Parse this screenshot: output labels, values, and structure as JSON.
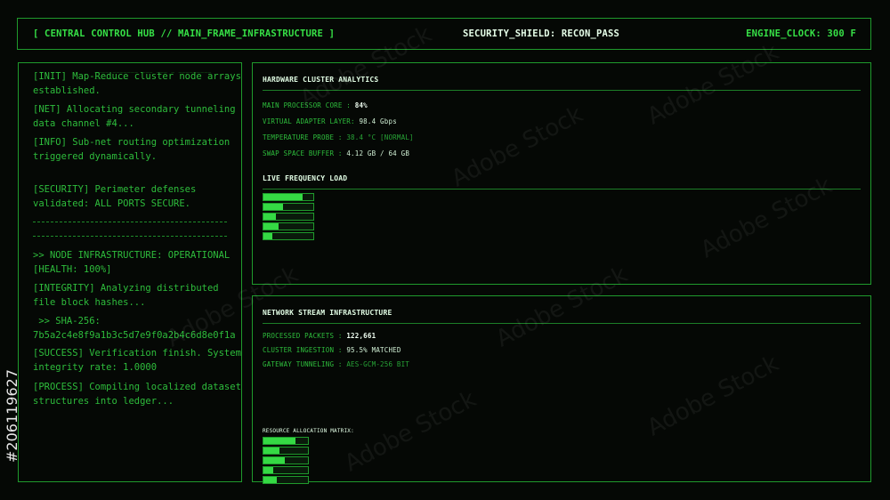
{
  "header": {
    "left": "[ CENTRAL CONTROL HUB // MAIN_FRAME_INFRASTRUCTURE ]",
    "middle": "SECURITY_SHIELD: RECON_PASS",
    "right": "ENGINE_CLOCK: 300 F"
  },
  "log": {
    "overlay": "____ _______ ___ ___ _ _________ _________",
    "entries": [
      "[INIT] Map-Reduce cluster node arrays established.",
      "[NET] Allocating secondary tunneling data channel #4...",
      "[INFO] Sub-net routing optimization triggered dynamically.",
      "[SECURITY] Perimeter defenses validated: ALL PORTS SECURE.",
      ">> NODE INFRASTRUCTURE: OPERATIONAL [HEALTH: 100%]",
      "[INTEGRITY] Analyzing distributed file block hashes...",
      " >> SHA-256:",
      "7b5a2c4e8f9a1b3c5d7e9f0a2b4c6d8e0f1a",
      "[SUCCESS] Verification finish. System integrity rate: 1.0000",
      "[PROCESS] Compiling localized dataset structures into ledger..."
    ]
  },
  "hardware": {
    "title": "HARDWARE CLUSTER ANALYTICS",
    "rows": [
      {
        "label": "MAIN PROCESSOR CORE :",
        "value": "84%"
      },
      {
        "label": "VIRTUAL ADAPTER LAYER:",
        "value": "98.4 Gbps"
      },
      {
        "label": "TEMPERATURE PROBE :",
        "value": "38.4 °C [NORMAL]"
      },
      {
        "label": "SWAP SPACE BUFFER :",
        "value": "4.12 GB / 64 GB"
      }
    ],
    "freq_title": "LIVE FREQUENCY LOAD",
    "freq_levels": [
      0.78,
      0.4,
      0.25,
      0.3,
      0.18
    ]
  },
  "network": {
    "title": "NETWORK STREAM INFRASTRUCTURE",
    "rows": [
      {
        "label": "PROCESSED PACKETS :",
        "value": "122,661"
      },
      {
        "label": "CLUSTER INGESTION :",
        "value": "95.5% MATCHED"
      },
      {
        "label": "GATEWAY TUNNELING :",
        "value": "AES-GCM-256 BIT"
      }
    ],
    "matrix_title": "RESOURCE ALLOCATION MATRIX:",
    "matrix_levels": [
      0.72,
      0.35,
      0.48,
      0.22,
      0.3
    ]
  },
  "watermark": {
    "text": "Adobe Stock",
    "id": "#206119627"
  },
  "colors": {
    "accent": "#36d944",
    "border": "#1f9a2c",
    "background": "#050805"
  }
}
